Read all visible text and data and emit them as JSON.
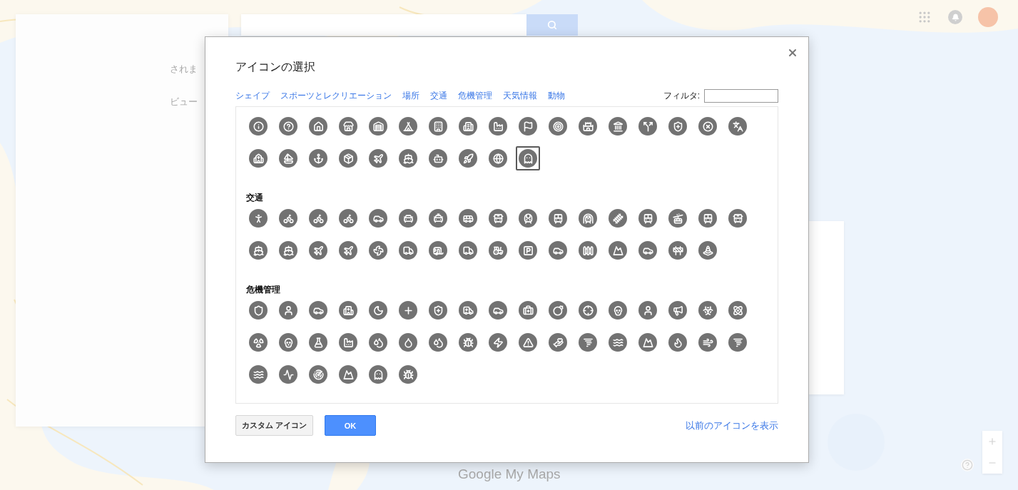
{
  "background": {
    "panel_texts": [
      "されま",
      "ビュー"
    ],
    "brand": "Google My Maps"
  },
  "dialog": {
    "title": "アイコンの選択",
    "categories": [
      "シェイプ",
      "スポーツとレクリエーション",
      "場所",
      "交通",
      "危機管理",
      "天気情報",
      "動物"
    ],
    "filter_label": "フィルタ:",
    "sections": [
      {
        "icons": [
          {
            "kind": "info",
            "selected": false
          },
          {
            "kind": "question",
            "selected": false
          },
          {
            "kind": "house",
            "selected": false
          },
          {
            "kind": "store",
            "selected": false
          },
          {
            "kind": "warehouse",
            "selected": false
          },
          {
            "kind": "tent",
            "selected": false
          },
          {
            "kind": "building",
            "selected": false
          },
          {
            "kind": "office",
            "selected": false
          },
          {
            "kind": "factory",
            "selected": false
          },
          {
            "kind": "flag",
            "selected": false
          },
          {
            "kind": "target",
            "selected": false
          },
          {
            "kind": "castle",
            "selected": false
          },
          {
            "kind": "landmark",
            "selected": false
          },
          {
            "kind": "split",
            "selected": false
          },
          {
            "kind": "shieldplus",
            "selected": false
          },
          {
            "kind": "circlex",
            "selected": false
          },
          {
            "kind": "languages",
            "selected": false
          },
          {
            "kind": "church",
            "selected": false
          },
          {
            "kind": "sailboat",
            "selected": false
          },
          {
            "kind": "anchor",
            "selected": false
          },
          {
            "kind": "package",
            "selected": false
          },
          {
            "kind": "plane",
            "selected": false
          },
          {
            "kind": "ship",
            "selected": false
          },
          {
            "kind": "bot",
            "selected": false
          },
          {
            "kind": "rocket",
            "selected": false
          },
          {
            "kind": "globe",
            "selected": false
          },
          {
            "kind": "ghost",
            "selected": true
          }
        ]
      },
      {
        "heading": "交通",
        "icons": [
          {
            "kind": "person",
            "selected": false
          },
          {
            "kind": "bike",
            "selected": false
          },
          {
            "kind": "bike",
            "selected": false
          },
          {
            "kind": "bike",
            "selected": false
          },
          {
            "kind": "car",
            "selected": false
          },
          {
            "kind": "carfront",
            "selected": false
          },
          {
            "kind": "taxi",
            "selected": false
          },
          {
            "kind": "bus",
            "selected": false
          },
          {
            "kind": "busfront",
            "selected": false
          },
          {
            "kind": "train",
            "selected": false
          },
          {
            "kind": "tram",
            "selected": false
          },
          {
            "kind": "tunneltrain",
            "selected": false
          },
          {
            "kind": "track",
            "selected": false
          },
          {
            "kind": "tram",
            "selected": false
          },
          {
            "kind": "cablecar",
            "selected": false
          },
          {
            "kind": "tram",
            "selected": false
          },
          {
            "kind": "busfront",
            "selected": false
          },
          {
            "kind": "ship",
            "selected": false
          },
          {
            "kind": "ship",
            "selected": false
          },
          {
            "kind": "plane",
            "selected": false
          },
          {
            "kind": "plane",
            "selected": false
          },
          {
            "kind": "fan",
            "selected": false
          },
          {
            "kind": "truck",
            "selected": false
          },
          {
            "kind": "caravan",
            "selected": false
          },
          {
            "kind": "truck",
            "selected": false
          },
          {
            "kind": "tractor",
            "selected": false
          },
          {
            "kind": "parking",
            "selected": false
          },
          {
            "kind": "car",
            "selected": false
          },
          {
            "kind": "fence",
            "selected": false
          },
          {
            "kind": "mountain",
            "selected": false
          },
          {
            "kind": "car",
            "selected": false
          },
          {
            "kind": "construction",
            "selected": false
          },
          {
            "kind": "cone",
            "selected": false
          }
        ]
      },
      {
        "heading": "危機管理",
        "icons": [
          {
            "kind": "shield",
            "selected": false
          },
          {
            "kind": "user",
            "selected": false
          },
          {
            "kind": "car",
            "selected": false
          },
          {
            "kind": "hospital",
            "selected": false
          },
          {
            "kind": "moon",
            "selected": false
          },
          {
            "kind": "plus",
            "selected": false
          },
          {
            "kind": "shieldplus",
            "selected": false
          },
          {
            "kind": "ambulance",
            "selected": false
          },
          {
            "kind": "car",
            "selected": false
          },
          {
            "kind": "medkit",
            "selected": false
          },
          {
            "kind": "bomb",
            "selected": false
          },
          {
            "kind": "crosshair",
            "selected": false
          },
          {
            "kind": "skull",
            "selected": false
          },
          {
            "kind": "user",
            "selected": false
          },
          {
            "kind": "megaphone",
            "selected": false
          },
          {
            "kind": "biohazard",
            "selected": false
          },
          {
            "kind": "atom",
            "selected": false
          },
          {
            "kind": "radiation",
            "selected": false
          },
          {
            "kind": "skull",
            "selected": false
          },
          {
            "kind": "flask",
            "selected": false
          },
          {
            "kind": "factory",
            "selected": false
          },
          {
            "kind": "droplets",
            "selected": false
          },
          {
            "kind": "droplet",
            "selected": false
          },
          {
            "kind": "droplets",
            "selected": false
          },
          {
            "kind": "bug",
            "selected": false
          },
          {
            "kind": "zap",
            "selected": false
          },
          {
            "kind": "warning",
            "selected": false
          },
          {
            "kind": "handheart",
            "selected": false
          },
          {
            "kind": "tornado",
            "selected": false
          },
          {
            "kind": "waves",
            "selected": false
          },
          {
            "kind": "mountain",
            "selected": false
          },
          {
            "kind": "flame",
            "selected": false
          },
          {
            "kind": "wind",
            "selected": false
          },
          {
            "kind": "tornado",
            "selected": false
          },
          {
            "kind": "waves",
            "selected": false
          },
          {
            "kind": "activity",
            "selected": false
          },
          {
            "kind": "radar",
            "selected": false
          },
          {
            "kind": "mountain",
            "selected": false
          },
          {
            "kind": "ghost",
            "selected": false
          },
          {
            "kind": "bug",
            "selected": false
          }
        ]
      }
    ],
    "buttons": [
      {
        "kind": "custom",
        "label": "カスタム アイコン"
      },
      {
        "kind": "ok",
        "label": "OK"
      }
    ],
    "legacy_link": "以前のアイコンを表示"
  }
}
